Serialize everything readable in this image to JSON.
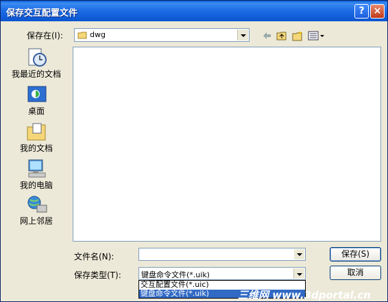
{
  "window": {
    "title": "保存交互配置文件"
  },
  "titlebar": {
    "help_label": "?",
    "close_label": "×"
  },
  "look_in": {
    "label": "保存在(I):",
    "value": "dwg"
  },
  "places": [
    {
      "label": "我最近的文档",
      "icon": "recent-documents-icon"
    },
    {
      "label": "桌面",
      "icon": "desktop-icon"
    },
    {
      "label": "我的文档",
      "icon": "my-documents-icon"
    },
    {
      "label": "我的电脑",
      "icon": "my-computer-icon"
    },
    {
      "label": "网上邻居",
      "icon": "network-places-icon"
    }
  ],
  "file_name": {
    "label": "文件名(N):",
    "value": ""
  },
  "file_type": {
    "label": "保存类型(T):",
    "value": "键盘命令文件(*.uik)",
    "options": [
      "交互配置文件(*.uic)",
      "键盘命令文件(*.uik)"
    ]
  },
  "buttons": {
    "save": "保存(S)",
    "cancel": "取消"
  },
  "watermark": "三维网 www.3dportal.cn",
  "colors": {
    "titlebar": "#0a54d0",
    "dialog_bg": "#ece9d8",
    "selection": "#316ac5"
  }
}
